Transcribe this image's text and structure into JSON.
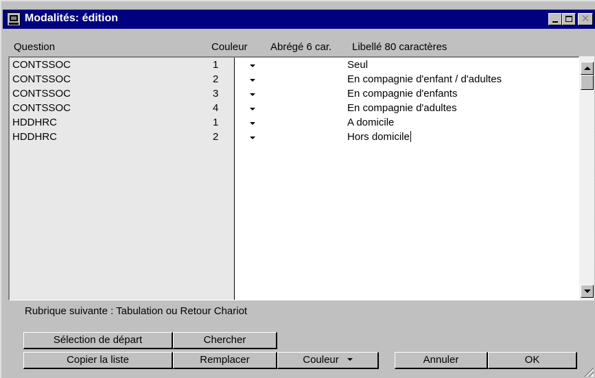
{
  "window": {
    "title": "Modalités: édition"
  },
  "headers": {
    "question": "Question",
    "couleur": "Couleur",
    "abrege": "Abrégé 6 car.",
    "libelle": "Libellé 80 caractères"
  },
  "rows": [
    {
      "question": "CONTSSOC",
      "num": "1",
      "libelle": "Seul"
    },
    {
      "question": "CONTSSOC",
      "num": "2",
      "libelle": "En compagnie d'enfant / d'adultes"
    },
    {
      "question": "CONTSSOC",
      "num": "3",
      "libelle": "En compagnie d'enfants"
    },
    {
      "question": "CONTSSOC",
      "num": "4",
      "libelle": "En compagnie d'adultes"
    },
    {
      "question": "HDDHRC",
      "num": "1",
      "libelle": "A domicile"
    },
    {
      "question": "HDDHRC",
      "num": "2",
      "libelle": "Hors domicile"
    }
  ],
  "status": "Rubrique suivante : Tabulation ou Retour Chariot",
  "buttons": {
    "selection_depart": "Sélection de départ",
    "chercher": "Chercher",
    "copier_liste": "Copier la liste",
    "remplacer": "Remplacer",
    "couleur": "Couleur",
    "annuler": "Annuler",
    "ok": "OK"
  },
  "colors": {
    "title_bar": "#000080",
    "face": "#c0c0c0",
    "list_left": "#e8e8e8"
  },
  "icons": [
    "app-icon",
    "minimize-icon",
    "maximize-icon",
    "close-icon",
    "dropdown-arrow-icon",
    "scroll-up-icon",
    "scroll-down-icon"
  ]
}
